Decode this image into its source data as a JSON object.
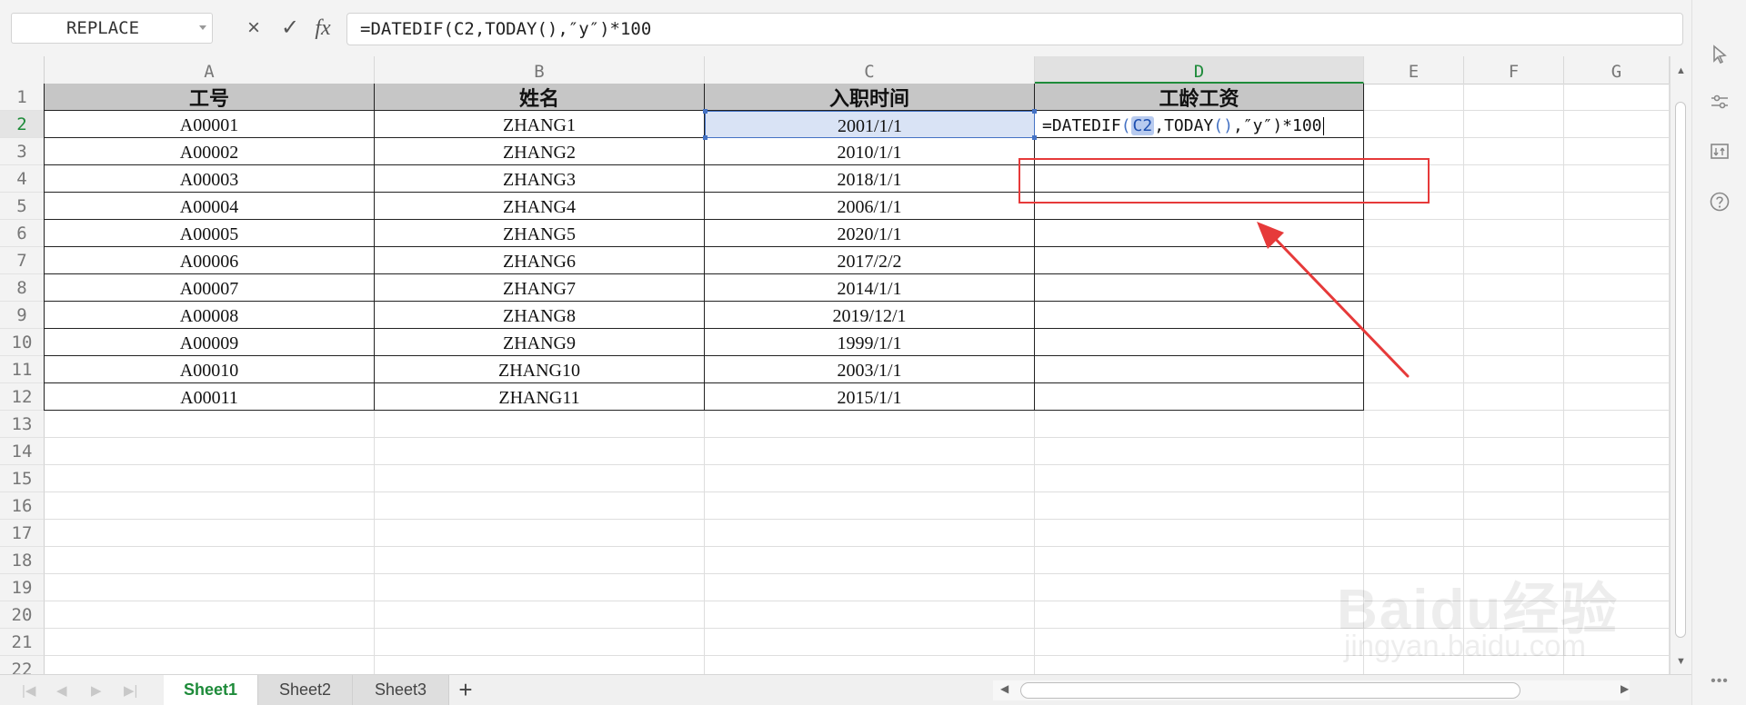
{
  "formula_bar": {
    "name_box": "REPLACE",
    "cancel_icon": "×",
    "enter_icon": "✓",
    "fx_label": "fx",
    "formula": "=DATEDIF(C2,TODAY(),″y″)*100"
  },
  "columns": [
    "A",
    "B",
    "C",
    "D",
    "E",
    "F",
    "G"
  ],
  "rows": [
    "1",
    "2",
    "3",
    "4",
    "5",
    "6",
    "7",
    "8",
    "9",
    "10",
    "11",
    "12",
    "13",
    "14",
    "15",
    "16",
    "17",
    "18",
    "19",
    "20",
    "21",
    "22"
  ],
  "table": {
    "headers": [
      "工号",
      "姓名",
      "入职时间",
      "工龄工资"
    ],
    "data": [
      [
        "A00001",
        "ZHANG1",
        "2001/1/1"
      ],
      [
        "A00002",
        "ZHANG2",
        "2010/1/1"
      ],
      [
        "A00003",
        "ZHANG3",
        "2018/1/1"
      ],
      [
        "A00004",
        "ZHANG4",
        "2006/1/1"
      ],
      [
        "A00005",
        "ZHANG5",
        "2020/1/1"
      ],
      [
        "A00006",
        "ZHANG6",
        "2017/2/2"
      ],
      [
        "A00007",
        "ZHANG7",
        "2014/1/1"
      ],
      [
        "A00008",
        "ZHANG8",
        "2019/12/1"
      ],
      [
        "A00009",
        "ZHANG9",
        "1999/1/1"
      ],
      [
        "A00010",
        "ZHANG10",
        "2003/1/1"
      ],
      [
        "A00011",
        "ZHANG11",
        "2015/1/1"
      ]
    ],
    "editing_cell": {
      "prefix": "=DATEDIF",
      "open_paren": "(",
      "ref": "C2",
      "middle": ",TODAY",
      "today_parens": "()",
      "suffix": ",″y″",
      "close": ")*100"
    }
  },
  "sheets": [
    "Sheet1",
    "Sheet2",
    "Sheet3"
  ],
  "active_sheet": "Sheet1",
  "add_sheet": "+",
  "right_panel_icons": [
    "select-icon",
    "settings-sliders-icon",
    "arrange-icon",
    "help-icon",
    "more-icon"
  ],
  "watermark": {
    "brand": "Baidu经验",
    "url": "jingyan.baidu.com"
  },
  "colors": {
    "accent_green": "#1e8b3a",
    "selection_blue": "#4472c4",
    "annotation_red": "#e63a3a",
    "header_gray": "#c6c6c6"
  }
}
